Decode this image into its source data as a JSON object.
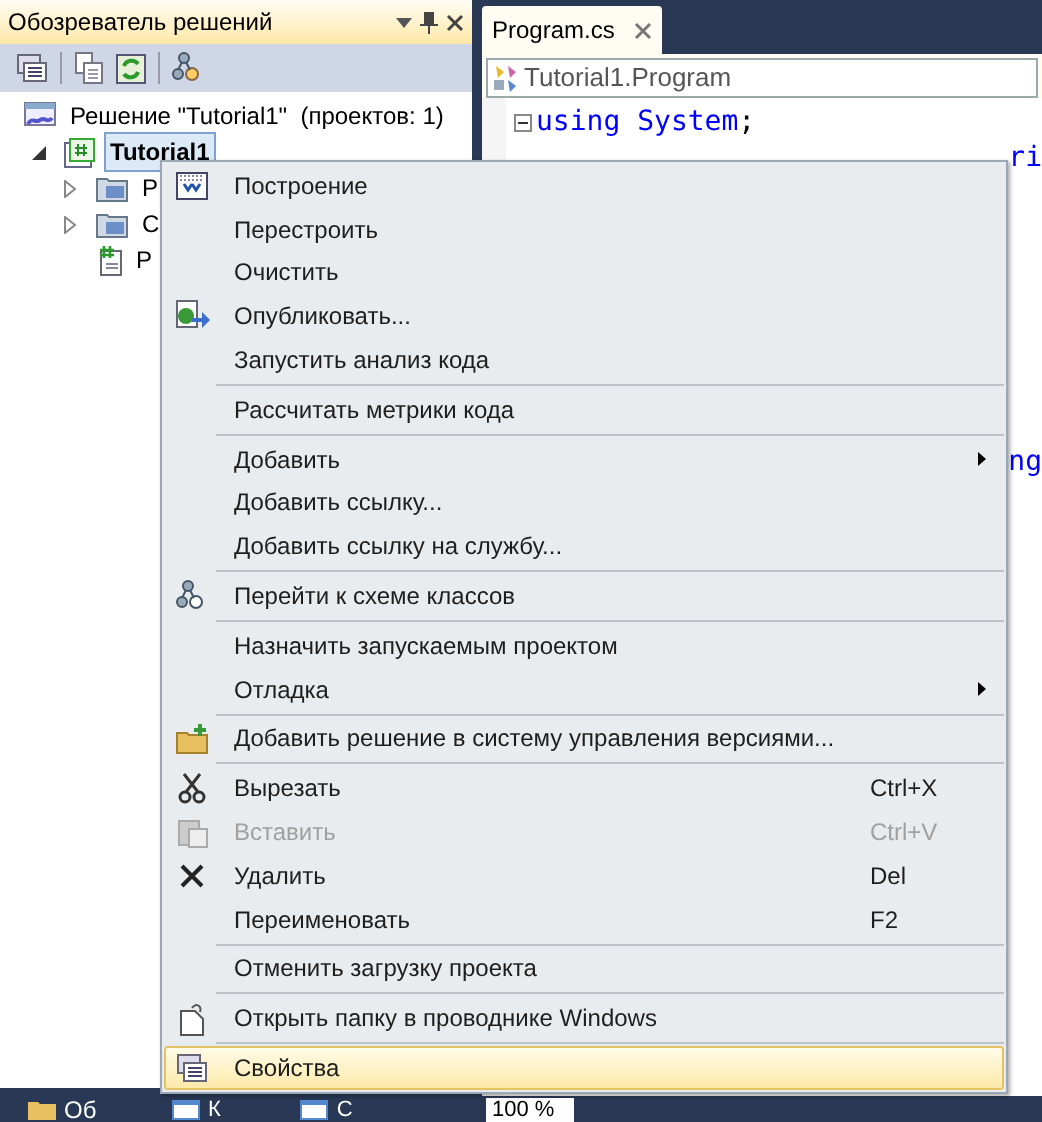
{
  "solution_explorer": {
    "title": "Обозреватель решений",
    "tree": [
      {
        "label": "Решение \"Tutorial1\"  (проектов: 1)",
        "selected": false,
        "children": [
          {
            "label": "Tutorial1",
            "selected": true,
            "expanded": true,
            "children": [
              {
                "label": "P",
                "selected": false,
                "expanded": false
              },
              {
                "label": "C",
                "selected": false,
                "expanded": false
              },
              {
                "label": "P",
                "selected": false
              }
            ]
          }
        ]
      }
    ],
    "bottom_tab": "Об"
  },
  "editor": {
    "tab": "Program.cs",
    "navigation": "Tutorial1.Program",
    "code": [
      {
        "keyword": "using",
        "name": "System",
        "end": ";"
      }
    ],
    "fragments": [
      "ri",
      "ng"
    ],
    "status": [
      "К",
      "С"
    ],
    "zoom": "100 %"
  },
  "context_menu": {
    "items": [
      {
        "kind": "item",
        "label": "Построение",
        "selected": false,
        "disabled": false
      },
      {
        "kind": "item",
        "label": "Перестроить",
        "selected": false,
        "disabled": false
      },
      {
        "kind": "item",
        "label": "Очистить",
        "selected": false,
        "disabled": false
      },
      {
        "kind": "item",
        "label": "Опубликовать...",
        "selected": false,
        "disabled": false
      },
      {
        "kind": "item",
        "label": "Запустить анализ кода",
        "selected": false,
        "disabled": false
      },
      {
        "kind": "separator"
      },
      {
        "kind": "item",
        "label": "Рассчитать метрики кода",
        "selected": false,
        "disabled": false
      },
      {
        "kind": "separator"
      },
      {
        "kind": "item",
        "label": "Добавить",
        "selected": false,
        "disabled": false,
        "submenu": true
      },
      {
        "kind": "item",
        "label": "Добавить ссылку...",
        "selected": false,
        "disabled": false
      },
      {
        "kind": "item",
        "label": "Добавить ссылку на службу...",
        "selected": false,
        "disabled": false
      },
      {
        "kind": "separator"
      },
      {
        "kind": "item",
        "label": "Перейти к схеме классов",
        "selected": false,
        "disabled": false
      },
      {
        "kind": "separator"
      },
      {
        "kind": "item",
        "label": "Назначить запускаемым проектом",
        "selected": false,
        "disabled": false
      },
      {
        "kind": "item",
        "label": "Отладка",
        "selected": false,
        "disabled": false,
        "submenu": true
      },
      {
        "kind": "separator"
      },
      {
        "kind": "item",
        "label": "Добавить решение в систему управления версиями...",
        "selected": false,
        "disabled": false
      },
      {
        "kind": "separator"
      },
      {
        "kind": "item",
        "label": "Вырезать",
        "shortcut": "Ctrl+X",
        "selected": false,
        "disabled": false
      },
      {
        "kind": "item",
        "label": "Вставить",
        "shortcut": "Ctrl+V",
        "selected": false,
        "disabled": true
      },
      {
        "kind": "item",
        "label": "Удалить",
        "shortcut": "Del",
        "selected": false,
        "disabled": false
      },
      {
        "kind": "item",
        "label": "Переименовать",
        "shortcut": "F2",
        "selected": false,
        "disabled": false
      },
      {
        "kind": "separator"
      },
      {
        "kind": "item",
        "label": "Отменить загрузку проекта",
        "selected": false,
        "disabled": false
      },
      {
        "kind": "separator"
      },
      {
        "kind": "item",
        "label": "Открыть папку в проводнике Windows",
        "selected": false,
        "disabled": false
      },
      {
        "kind": "separator"
      },
      {
        "kind": "item",
        "label": "Свойства",
        "selected": true,
        "disabled": false
      }
    ]
  }
}
